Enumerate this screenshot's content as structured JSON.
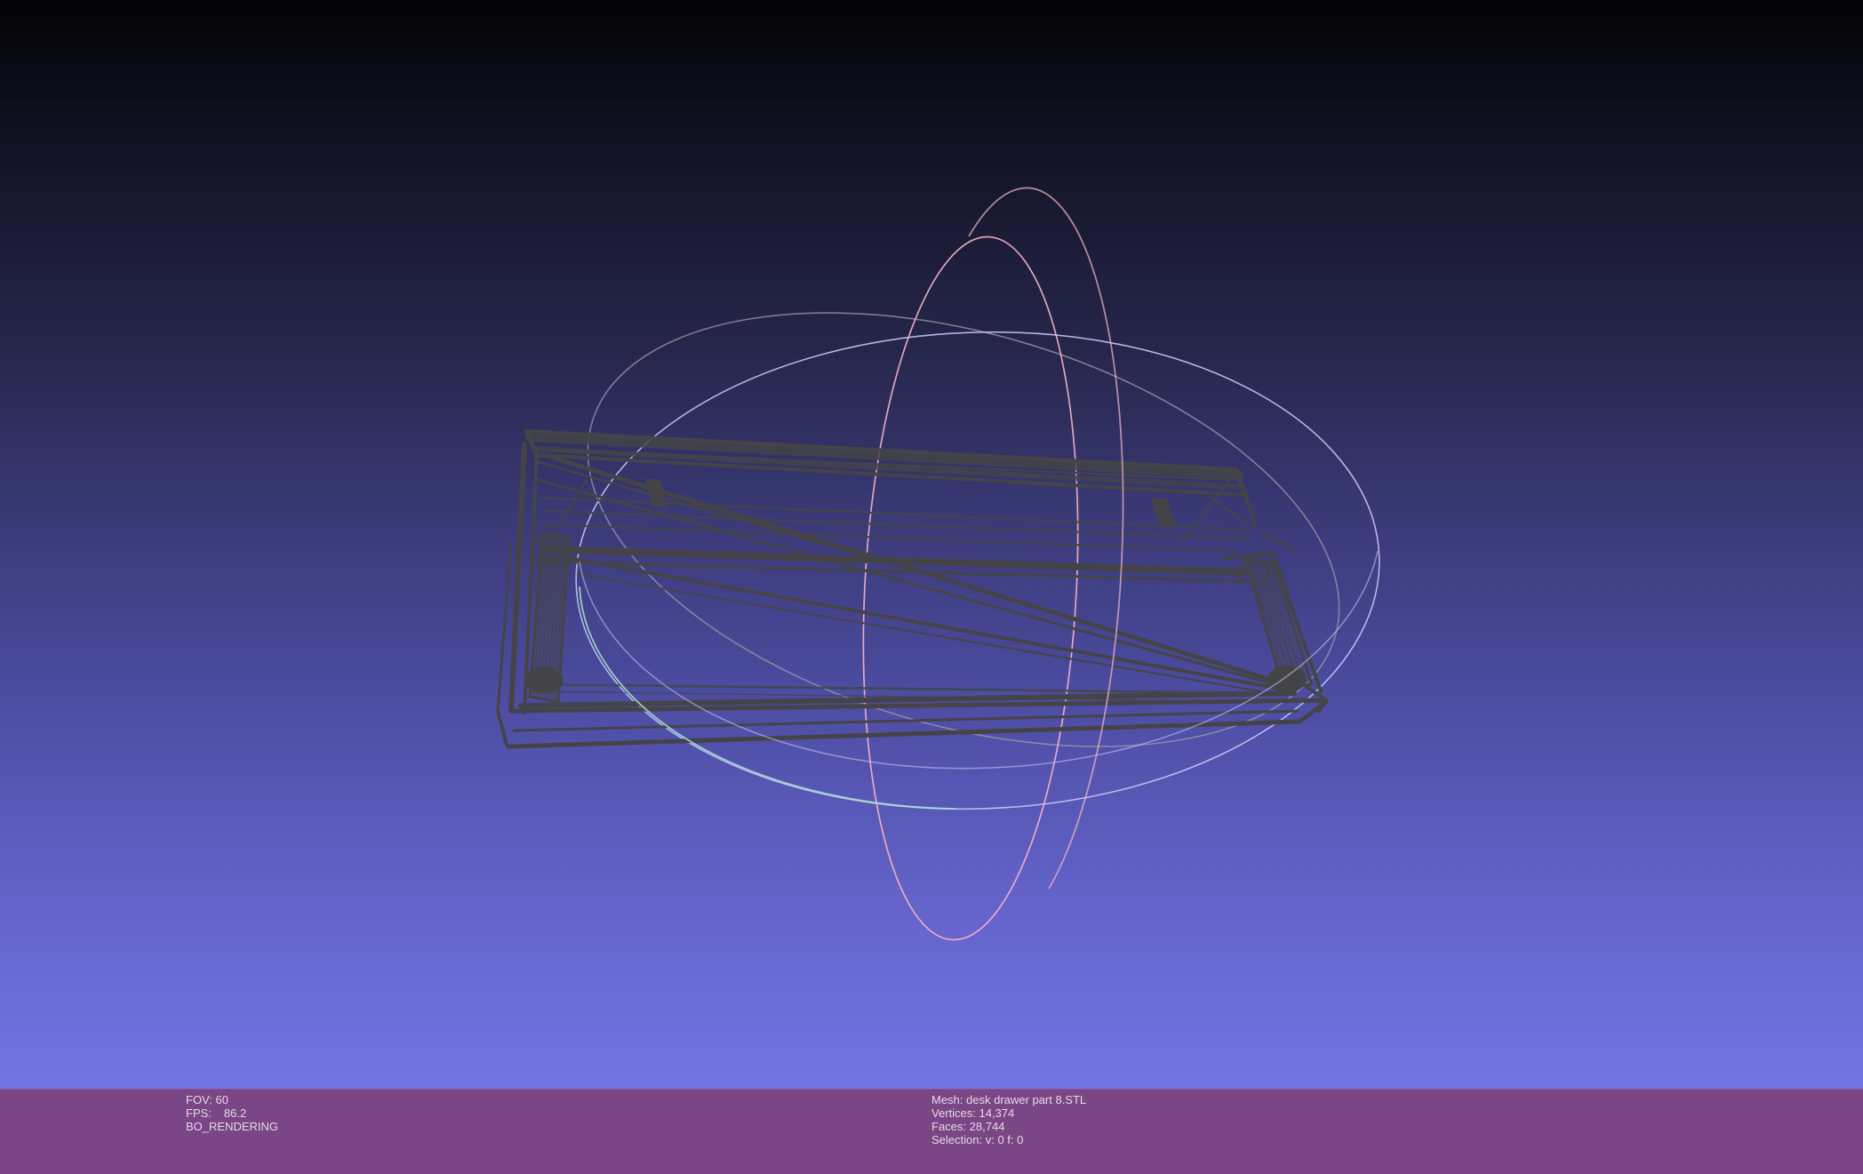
{
  "app": {
    "name": "MeshLab 3D viewport"
  },
  "viewport": {
    "background_top": "#030306",
    "background_bottom": "#7474e6",
    "mesh_color": "#444448",
    "trackball_colors": {
      "horizontal": "#b8b8f0",
      "vertical": "#f0a8b8",
      "outer": "#a8e0c8"
    },
    "icons": [
      "trackball-icon",
      "mesh-wireframe"
    ]
  },
  "info_bar": {
    "background": "#7b4685",
    "left": {
      "fov_label": "FOV:",
      "fov_value": "60",
      "fps_label": "FPS:",
      "fps_value": "86.2",
      "render_mode": "BO_RENDERING"
    },
    "right": {
      "mesh_label": "Mesh:",
      "mesh_name": "desk drawer part 8.STL",
      "vertices_label": "Vertices:",
      "vertices_value": "14,374",
      "faces_label": "Faces:",
      "faces_value": "28,744",
      "selection_label": "Selection:",
      "selection_value": "v: 0 f: 0"
    }
  }
}
